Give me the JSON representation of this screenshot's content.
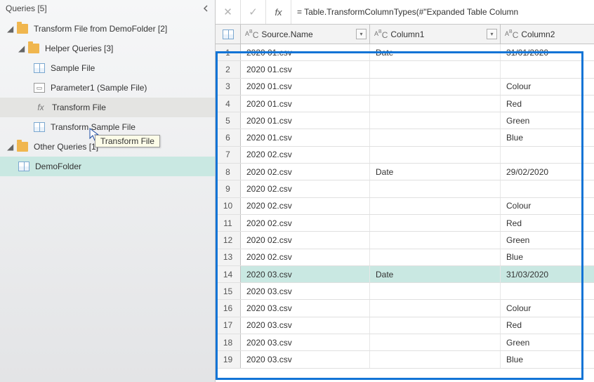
{
  "queries": {
    "panel_title": "Queries [5]",
    "groups": [
      {
        "label": "Transform File from DemoFolder [2]"
      },
      {
        "label": "Helper Queries [3]"
      },
      {
        "label": "Other Queries [1]"
      }
    ],
    "items": {
      "sample_file": "Sample File",
      "parameter1": "Parameter1 (Sample File)",
      "transform_file": "Transform File",
      "transform_sample_file": "Transform Sample File",
      "demo_folder": "DemoFolder"
    },
    "tooltip": "Transform File"
  },
  "formula": {
    "text": "= Table.TransformColumnTypes(#\"Expanded Table Column"
  },
  "columns": {
    "source": "Source.Name",
    "c1": "Column1",
    "c2": "Column2"
  },
  "rows": [
    {
      "n": 1,
      "src": "2020 01.csv",
      "c1": "Date",
      "c2": "31/01/2020",
      "hl": false
    },
    {
      "n": 2,
      "src": "2020 01.csv",
      "c1": "",
      "c2": "",
      "hl": false
    },
    {
      "n": 3,
      "src": "2020 01.csv",
      "c1": "",
      "c2": "Colour",
      "hl": false
    },
    {
      "n": 4,
      "src": "2020 01.csv",
      "c1": "",
      "c2": "Red",
      "hl": false
    },
    {
      "n": 5,
      "src": "2020 01.csv",
      "c1": "",
      "c2": "Green",
      "hl": false
    },
    {
      "n": 6,
      "src": "2020 01.csv",
      "c1": "",
      "c2": "Blue",
      "hl": false
    },
    {
      "n": 7,
      "src": "2020 02.csv",
      "c1": "",
      "c2": "",
      "hl": false
    },
    {
      "n": 8,
      "src": "2020 02.csv",
      "c1": "Date",
      "c2": "29/02/2020",
      "hl": false
    },
    {
      "n": 9,
      "src": "2020 02.csv",
      "c1": "",
      "c2": "",
      "hl": false
    },
    {
      "n": 10,
      "src": "2020 02.csv",
      "c1": "",
      "c2": "Colour",
      "hl": false
    },
    {
      "n": 11,
      "src": "2020 02.csv",
      "c1": "",
      "c2": "Red",
      "hl": false
    },
    {
      "n": 12,
      "src": "2020 02.csv",
      "c1": "",
      "c2": "Green",
      "hl": false
    },
    {
      "n": 13,
      "src": "2020 02.csv",
      "c1": "",
      "c2": "Blue",
      "hl": false
    },
    {
      "n": 14,
      "src": "2020 03.csv",
      "c1": "Date",
      "c2": "31/03/2020",
      "hl": true
    },
    {
      "n": 15,
      "src": "2020 03.csv",
      "c1": "",
      "c2": "",
      "hl": false
    },
    {
      "n": 16,
      "src": "2020 03.csv",
      "c1": "",
      "c2": "Colour",
      "hl": false
    },
    {
      "n": 17,
      "src": "2020 03.csv",
      "c1": "",
      "c2": "Red",
      "hl": false
    },
    {
      "n": 18,
      "src": "2020 03.csv",
      "c1": "",
      "c2": "Green",
      "hl": false
    },
    {
      "n": 19,
      "src": "2020 03.csv",
      "c1": "",
      "c2": "Blue",
      "hl": false
    }
  ]
}
